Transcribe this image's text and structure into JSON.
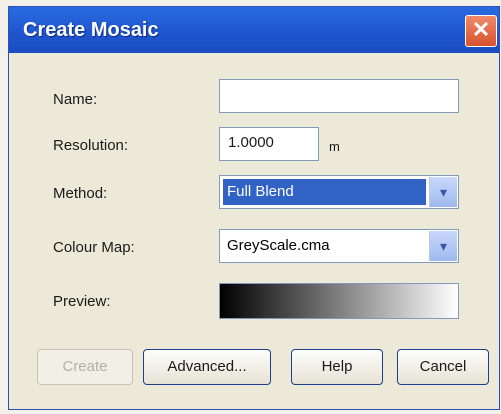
{
  "dialog": {
    "title": "Create Mosaic",
    "close_symbol": "✕"
  },
  "form": {
    "name_label": "Name:",
    "name_value": "",
    "resolution_label": "Resolution:",
    "resolution_value": "1.0000",
    "resolution_unit": "m",
    "method_label": "Method:",
    "method_value": "Full Blend",
    "colour_map_label": "Colour Map:",
    "colour_map_value": "GreyScale.cma",
    "preview_label": "Preview:",
    "preview_gradient": [
      "#000000",
      "#ffffff"
    ]
  },
  "buttons": {
    "create": "Create",
    "advanced": "Advanced...",
    "help": "Help",
    "cancel": "Cancel"
  },
  "icons": {
    "dropdown_arrow": "▾"
  }
}
